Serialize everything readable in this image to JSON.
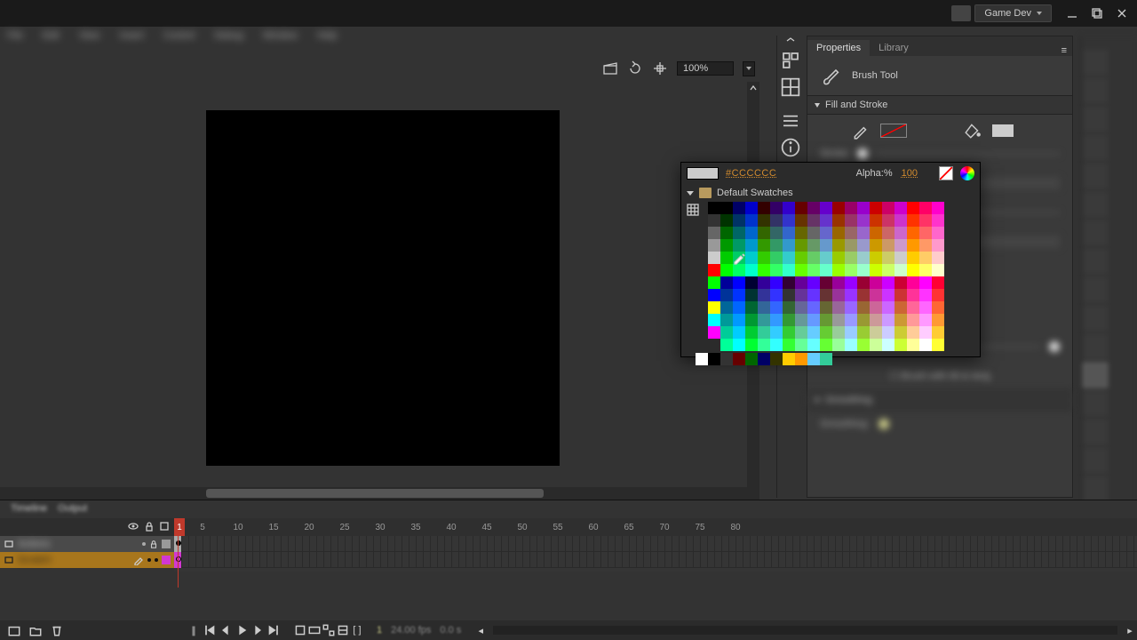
{
  "titlebar": {
    "workspace_label": "Game Dev"
  },
  "menubar": {
    "items": [
      "File",
      "Edit",
      "View",
      "Insert",
      "Modify",
      "Text",
      "Commands",
      "Control",
      "Debug",
      "Window",
      "Help"
    ]
  },
  "stage": {
    "zoom": "100%"
  },
  "panels": {
    "tabs": {
      "properties": "Properties",
      "library": "Library"
    },
    "tool_label": "Brush Tool",
    "fill_stroke_label": "Fill and Stroke",
    "brush_label": "Brush:",
    "size_label": "Size:",
    "smoothing_section": "Smoothing",
    "smoothing_label": "Smoothing:"
  },
  "picker": {
    "hex": "#CCCCCC",
    "alpha_label": "Alpha:%",
    "alpha_value": "100",
    "swatch_set_label": "Default Swatches",
    "greys": [
      "#000000",
      "#333333",
      "#666666",
      "#999999",
      "#cccccc",
      "#ffffff"
    ],
    "quick": [
      "#ff0000",
      "#00ff00",
      "#0000ff",
      "#ffff00",
      "#00ffff",
      "#ff00ff"
    ],
    "bottom_row": [
      "#ffffff",
      "#000000",
      "#333333",
      "#660000",
      "#006600",
      "#000066",
      "#333300",
      "#ffcc00",
      "#ff9900",
      "#66ccff",
      "#33cc99"
    ],
    "r_levels": [
      "00",
      "33",
      "66",
      "99",
      "cc",
      "ff"
    ],
    "g_levels": [
      "00",
      "33",
      "66",
      "99",
      "cc",
      "ff"
    ],
    "b_levels": [
      "00",
      "33",
      "66",
      "99",
      "cc",
      "ff"
    ]
  },
  "timeline": {
    "tabs": {
      "timeline": "Timeline",
      "output": "Output"
    },
    "ruler_ticks": [
      "5",
      "10",
      "15",
      "20",
      "25",
      "30",
      "35",
      "40",
      "45",
      "50",
      "55",
      "60",
      "65",
      "70",
      "75",
      "80"
    ],
    "frame_one": "1",
    "layers": [
      {
        "name": "Actions"
      },
      {
        "name": "Scratch"
      }
    ],
    "readouts": {
      "frame": "1",
      "fps": "24.00 fps",
      "time": "0.0 s"
    }
  }
}
